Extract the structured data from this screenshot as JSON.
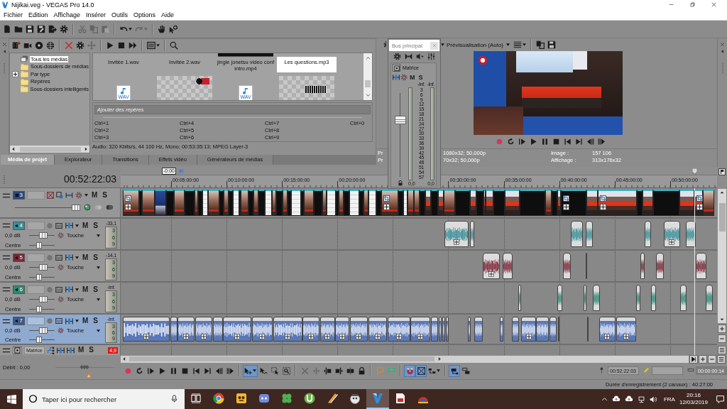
{
  "window": {
    "title": "Nijikai.veg - VEGAS Pro 14.0"
  },
  "menu": [
    "Fichier",
    "Edition",
    "Affichage",
    "Insérer",
    "Outils",
    "Options",
    "Aide"
  ],
  "main_toolbar": [
    [
      {
        "kind": "new",
        "disabled": false
      },
      {
        "kind": "open",
        "disabled": false
      },
      {
        "kind": "save",
        "disabled": false
      },
      {
        "kind": "save-as",
        "disabled": false
      },
      {
        "kind": "render",
        "disabled": false
      },
      {
        "kind": "properties",
        "disabled": false
      }
    ],
    [
      {
        "kind": "cut",
        "disabled": true
      },
      {
        "kind": "copy",
        "disabled": true
      },
      {
        "kind": "paste",
        "disabled": true
      }
    ],
    [
      {
        "kind": "undo",
        "disabled": false
      },
      {
        "kind": "redo",
        "disabled": true
      }
    ],
    [
      {
        "kind": "tutorial",
        "disabled": false
      },
      {
        "kind": "help",
        "disabled": false
      }
    ]
  ],
  "project_media": {
    "toolbar": [
      [
        {
          "kind": "import",
          "disabled": false
        },
        {
          "kind": "capture",
          "disabled": false
        },
        {
          "kind": "extract",
          "disabled": false
        },
        {
          "kind": "web",
          "disabled": false
        }
      ],
      [
        {
          "kind": "remove",
          "disabled": false
        },
        {
          "kind": "properties",
          "disabled": false
        },
        {
          "kind": "move",
          "disabled": true
        }
      ],
      [
        {
          "kind": "play",
          "disabled": false
        },
        {
          "kind": "stop",
          "disabled": false
        },
        {
          "kind": "autoplay",
          "disabled": false
        }
      ],
      [
        {
          "kind": "views",
          "disabled": false
        }
      ],
      [
        {
          "kind": "search",
          "disabled": false
        }
      ]
    ],
    "tree": [
      {
        "label": "Tous les médias",
        "kind": "all",
        "selected": true
      },
      {
        "label": "Sous-dossiers de médias",
        "kind": "folder",
        "selected": false
      },
      {
        "label": "Par type",
        "kind": "group",
        "expanded": false,
        "selected": false
      },
      {
        "label": "Repères",
        "kind": "folder",
        "selected": false
      },
      {
        "label": "Sous-dossiers intelligents",
        "kind": "folder",
        "selected": false
      }
    ],
    "files": [
      {
        "name": "Invitée 1.wav",
        "kind": "audio",
        "selected": false
      },
      {
        "name": "Invitée 2.wav",
        "kind": "audio",
        "selected": false
      },
      {
        "name": "jingle jonetsu video conf intro.mp4",
        "kind": "video",
        "selected": false
      },
      {
        "name": "Les questions.mp3",
        "kind": "audio",
        "selected": true
      }
    ],
    "next_row": [
      {
        "kind": "audio",
        "badge": "WAV"
      },
      {
        "kind": "logo-image"
      },
      {
        "kind": "audio",
        "badge": "WAV"
      },
      {
        "kind": "title-image"
      }
    ],
    "marker_field": {
      "placeholder": "Ajouter des repères"
    },
    "shortcuts": [
      "Ctrl+1",
      "Ctrl+2",
      "Ctrl+3",
      "Ctrl+4",
      "Ctrl+5",
      "Ctrl+6",
      "Ctrl+7",
      "Ctrl+8",
      "Ctrl+9",
      "Ctrl+0"
    ],
    "info": "Audio: 320 Kbits/s, 44 100 Hz, Mono; 00:53:35:13; MPEG Layer-3"
  },
  "dock_tabs": [
    {
      "label": "Média de projet",
      "selected": true
    },
    {
      "label": "Explorateur",
      "selected": false
    },
    {
      "label": "Transitions",
      "selected": false
    },
    {
      "label": "Effets vidéo",
      "selected": false
    },
    {
      "label": "Générateurs de médias",
      "selected": false
    }
  ],
  "mixer": {
    "bus": "Bus principal",
    "channel": "Matrice",
    "mute": "M",
    "solo": "S",
    "peaks": [
      "-Inf.",
      "-Inf."
    ],
    "scale": [
      "3",
      "6",
      "9",
      "12",
      "15",
      "18",
      "21",
      "24",
      "27",
      "30",
      "33",
      "36",
      "39",
      "42",
      "45",
      "48",
      "51",
      "54",
      "57"
    ],
    "readings": [
      "0,0",
      "0,0"
    ],
    "fader": {
      "level": 0.68
    }
  },
  "preview": {
    "toolbar_left": [
      [
        {
          "kind": "properties",
          "disabled": false
        }
      ]
    ],
    "quality": "Prévisualisation (Auto)",
    "toolbar": [
      [
        {
          "kind": "overlays",
          "disabled": false
        }
      ],
      [
        {
          "kind": "copy-frame",
          "disabled": false
        },
        {
          "kind": "save-frame",
          "disabled": false
        }
      ]
    ],
    "transport": [
      [
        {
          "kind": "record",
          "disabled": false
        },
        {
          "kind": "loop",
          "disabled": false
        },
        {
          "kind": "play-start",
          "disabled": false
        },
        {
          "kind": "play",
          "disabled": false
        },
        {
          "kind": "pause",
          "disabled": false
        },
        {
          "kind": "stop",
          "disabled": false
        },
        {
          "kind": "go-start",
          "disabled": false
        },
        {
          "kind": "go-end",
          "disabled": false
        },
        {
          "kind": "prev-frame",
          "disabled": false
        },
        {
          "kind": "next-frame",
          "disabled": false
        }
      ]
    ],
    "info": [
      {
        "prefix": "Pr",
        "value": "1080x32; 50,000p",
        "label": "Image :",
        "reading": "157 106"
      },
      {
        "prefix": "Pr",
        "value": "70x32; 50,000p",
        "label": "Affichage :",
        "reading": "313x176x32"
      }
    ]
  },
  "timeline": {
    "timecode": "00:52:22:03",
    "marker": "-0:00",
    "ruler": [
      "00:05:00:00",
      "00:10:00:00",
      "00:15:00:00",
      "00:20:00:00",
      "00:30:00:00",
      "00:35:00:00",
      "00:40:00:00",
      "00:45:00:00",
      "00:50:00:00"
    ],
    "tracks": [
      {
        "kind": "video",
        "number": "3",
        "color": "#2c4a7c",
        "selected": false,
        "mute": "M",
        "solo": "S",
        "opacity": {
          "level": 0.93
        }
      },
      {
        "kind": "audio",
        "number": "4",
        "color": "#3a8e98",
        "selected": false,
        "mute": "M",
        "solo": "S",
        "peak": "-33,1",
        "meter_scale": [
          "3",
          "6",
          "9"
        ],
        "volume": {
          "reading": "0,0 dB",
          "level": 0.55
        },
        "automation": "Touche",
        "pan": {
          "reading": "Centre",
          "level": 0.4
        }
      },
      {
        "kind": "audio",
        "number": "5",
        "color": "#7a2636",
        "selected": false,
        "mute": "M",
        "solo": "S",
        "peak": "-14,1",
        "meter_scale": [
          "3",
          "6",
          "9"
        ],
        "volume": {
          "reading": "0,0 dB",
          "level": 0.55
        },
        "automation": "Touche",
        "pan": {
          "reading": "Centre",
          "level": 0.4
        }
      },
      {
        "kind": "audio",
        "number": "6",
        "color": "#2e8a72",
        "selected": false,
        "mute": "M",
        "solo": "S",
        "peak": "-Inf.",
        "meter_scale": [
          "3",
          "6",
          "9"
        ],
        "volume": {
          "reading": "0,0 dB",
          "level": 0.55
        },
        "automation": "Touche",
        "pan": {
          "reading": "Centre",
          "level": 0.4
        }
      },
      {
        "kind": "audio",
        "number": "7",
        "color": "#3c5a8c",
        "selected": true,
        "mute": "M",
        "solo": "S",
        "peak": "-Inf.",
        "meter_scale": [
          "3",
          "6",
          "9"
        ],
        "volume": {
          "reading": "0,0 dB",
          "level": 0.55
        },
        "automation": "Touche",
        "pan": {
          "reading": "Centre",
          "level": 0.4
        }
      }
    ],
    "master": {
      "label": "Matrice",
      "mute": "M",
      "solo": "S",
      "peak": "4,9",
      "clipped": true
    }
  },
  "bottom": {
    "rate": {
      "label": "Débit : 0,00",
      "level": 0.5
    },
    "toolbar": [
      [
        {
          "kind": "record",
          "selected": false,
          "disabled": false
        },
        {
          "kind": "loop",
          "selected": false,
          "disabled": false
        },
        {
          "kind": "play-start",
          "selected": false,
          "disabled": false
        },
        {
          "kind": "play",
          "selected": false,
          "disabled": false
        },
        {
          "kind": "pause",
          "selected": false,
          "disabled": false
        },
        {
          "kind": "stop",
          "selected": false,
          "disabled": false
        },
        {
          "kind": "go-start",
          "selected": false,
          "disabled": false
        },
        {
          "kind": "go-end",
          "selected": false,
          "disabled": false
        },
        {
          "kind": "prev-frame",
          "selected": false,
          "disabled": false
        },
        {
          "kind": "next-frame",
          "selected": false,
          "disabled": false
        }
      ],
      [
        {
          "kind": "edit-tool",
          "selected": true,
          "disabled": false
        },
        {
          "kind": "envelope-tool",
          "selected": false,
          "disabled": false
        },
        {
          "kind": "selection-tool",
          "selected": false,
          "disabled": false
        },
        {
          "kind": "zoom-tool",
          "selected": false,
          "disabled": false
        }
      ],
      [
        {
          "kind": "delete",
          "selected": false,
          "disabled": true
        },
        {
          "kind": "trim",
          "selected": false,
          "disabled": true
        },
        {
          "kind": "trim-start",
          "selected": false,
          "disabled": false
        },
        {
          "kind": "trim-end",
          "selected": false,
          "disabled": false
        },
        {
          "kind": "split",
          "selected": false,
          "disabled": false
        },
        {
          "kind": "lock",
          "selected": false,
          "disabled": false
        }
      ],
      [
        {
          "kind": "marker",
          "selected": false,
          "disabled": false
        },
        {
          "kind": "region",
          "selected": false,
          "disabled": false
        }
      ],
      [
        {
          "kind": "snap",
          "selected": true,
          "disabled": false
        },
        {
          "kind": "crossfade",
          "selected": true,
          "disabled": false
        },
        {
          "kind": "ripple",
          "selected": false,
          "disabled": false
        }
      ],
      [
        {
          "kind": "lock-envelopes",
          "selected": true,
          "disabled": false
        },
        {
          "kind": "ignore-grouping",
          "selected": false,
          "disabled": false
        }
      ]
    ],
    "time_fields": [
      {
        "value": "00:52:22:03",
        "disabled": false
      },
      {
        "disabled": false
      },
      {
        "value": "00:00:00:14",
        "disabled": true
      }
    ],
    "record_time": "Durée d'enregistrement (2 canaux) : 40:27:00"
  },
  "taskbar": {
    "search": {
      "placeholder": "Taper ici pour rechercher"
    },
    "apps": [
      {
        "kind": "browser",
        "active": false
      },
      {
        "kind": "face",
        "active": false
      },
      {
        "kind": "chat",
        "active": false
      },
      {
        "kind": "clover",
        "active": false
      },
      {
        "kind": "torrent",
        "active": false
      },
      {
        "kind": "tool",
        "active": false
      },
      {
        "kind": "camera",
        "active": false
      },
      {
        "kind": "editor",
        "active": true
      },
      {
        "kind": "document",
        "active": false
      },
      {
        "kind": "cap",
        "active": false
      }
    ],
    "language": "FRA",
    "time": "20:16",
    "date": "12/03/2019"
  }
}
